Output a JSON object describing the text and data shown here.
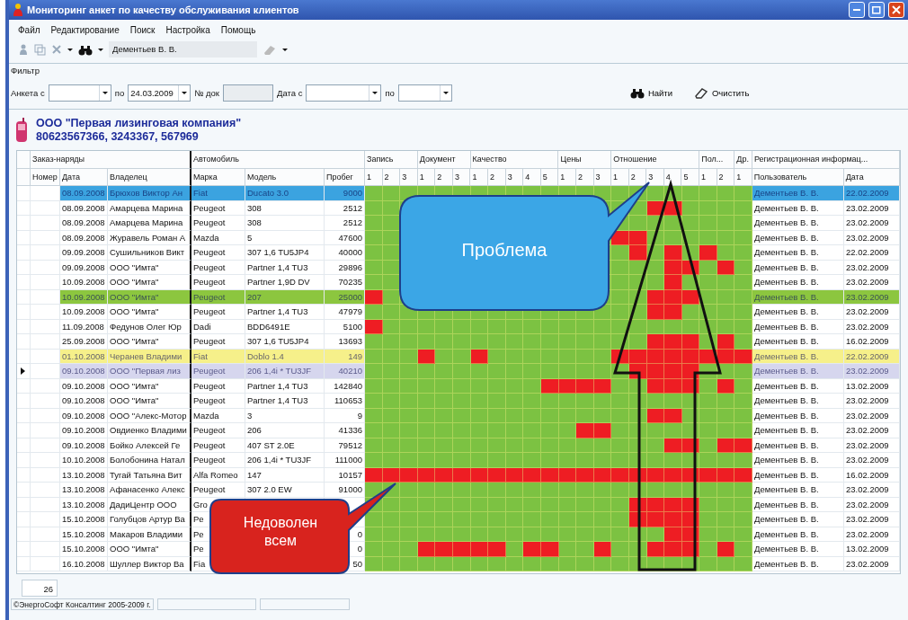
{
  "window": {
    "title": "Мониторинг анкет по качеству обслуживания клиентов"
  },
  "menu": [
    "Файл",
    "Редактирование",
    "Поиск",
    "Настройка",
    "Помощь"
  ],
  "toolbar": {
    "user_field": "Дементьев В. В."
  },
  "filter": {
    "title": "Фильтр",
    "fields": [
      {
        "label": "Анкета с",
        "kind": "combo"
      },
      {
        "label": "по",
        "kind": "combo",
        "value": "24.03.2009"
      },
      {
        "label": "№ док",
        "kind": "text"
      },
      {
        "label": "Дата с",
        "kind": "combo"
      },
      {
        "label": "по",
        "kind": "combo"
      }
    ],
    "buttons": [
      {
        "label": "Найти",
        "kind": "find"
      },
      {
        "label": "Очистить",
        "kind": "clear"
      }
    ]
  },
  "company": {
    "name": "ООО \"Первая лизинговая компания\"",
    "phones": "80623567366, 3243367, 567969"
  },
  "table": {
    "column_groups": [
      {
        "label": "Заказ-наряды",
        "kind": "order",
        "columns": [
          "Номер",
          "Дата",
          "Владелец"
        ]
      },
      {
        "label": "Автомобиль",
        "kind": "car",
        "columns": [
          "Марка",
          "Модель",
          "Пробег"
        ]
      },
      {
        "label": "Запись",
        "kind": "rating",
        "columns": [
          "1",
          "2",
          "3"
        ]
      },
      {
        "label": "Документ",
        "kind": "rating",
        "columns": [
          "1",
          "2",
          "3"
        ]
      },
      {
        "label": "Качество",
        "kind": "rating",
        "columns": [
          "1",
          "2",
          "3",
          "4",
          "5"
        ]
      },
      {
        "label": "Цены",
        "kind": "rating",
        "columns": [
          "1",
          "2",
          "3"
        ]
      },
      {
        "label": "Отношение",
        "kind": "rating",
        "columns": [
          "1",
          "2",
          "3",
          "4",
          "5"
        ]
      },
      {
        "label": "Пол...",
        "kind": "rating",
        "columns": [
          "1",
          "2"
        ]
      },
      {
        "label": "Др.",
        "kind": "rating",
        "columns": [
          "1"
        ]
      },
      {
        "label": "Регистрационная информац...",
        "kind": "registration",
        "columns": [
          "Пользователь",
          "Дата"
        ]
      }
    ],
    "rows": [
      {
        "date": "08.09.2008",
        "owner": "Брюхов Виктор Ан",
        "make": "Fiat",
        "model": "Ducato 3.0",
        "mileage": "9000",
        "complaints": [
          false,
          false,
          false,
          false,
          false,
          false,
          false,
          false,
          false,
          false,
          false,
          false,
          false,
          false,
          false,
          false,
          false,
          false,
          false,
          false,
          false,
          false
        ],
        "user": "Дементьев В. В.",
        "reg_date": "22.02.2009",
        "selected": false,
        "color": "#3ba3e0"
      },
      {
        "date": "08.09.2008",
        "owner": "Амарцева Марина",
        "make": "Peugeot",
        "model": "308",
        "mileage": "2512",
        "complaints": [
          false,
          false,
          false,
          false,
          false,
          false,
          true,
          true,
          false,
          false,
          false,
          false
        ],
        "user": "Дементьев В. В.",
        "reg_date": "23.02.2009",
        "selected": false
      },
      {
        "date": "08.09.2008",
        "owner": "Амарцева Марина",
        "make": "Peugeot",
        "model": "308",
        "mileage": "2512",
        "complaints": [
          false,
          false,
          false,
          false,
          false,
          false,
          false,
          false,
          false,
          false
        ],
        "user": "Дементьев В. В.",
        "reg_date": "23.02.2009",
        "selected": false
      },
      {
        "date": "08.09.2008",
        "owner": "Журавель Роман А",
        "make": "Mazda",
        "model": "5",
        "mileage": "47600",
        "complaints": [
          false,
          false,
          false,
          true,
          true,
          false,
          false,
          false,
          false,
          false,
          false
        ],
        "user": "Дементьев В. В.",
        "reg_date": "23.02.2009",
        "selected": false
      },
      {
        "date": "09.09.2008",
        "owner": "Сушильников Викт",
        "make": "Peugeot",
        "model": "307 1,6 TU5JP4",
        "mileage": "40000",
        "complaints": [
          false,
          false,
          false,
          false,
          true,
          false,
          true,
          false,
          true,
          false,
          false
        ],
        "user": "Дементьев В. В.",
        "reg_date": "22.02.2009",
        "selected": false
      },
      {
        "date": "09.09.2008",
        "owner": "ООО \"Имта\"",
        "make": "Peugeot",
        "model": "Partner 1,4 TU3",
        "mileage": "29896",
        "complaints": [
          false,
          false,
          false,
          false,
          false,
          false,
          true,
          true,
          false,
          true,
          false
        ],
        "user": "Дементьев В. В.",
        "reg_date": "23.02.2009",
        "selected": false
      },
      {
        "date": "10.09.2008",
        "owner": "ООО \"Имта\"",
        "make": "Peugeot",
        "model": "Partner 1,9D DV",
        "mileage": "70235",
        "complaints": [
          false,
          false,
          false,
          false,
          false,
          false,
          true,
          false,
          false,
          false,
          false
        ],
        "user": "Дементьев В. В.",
        "reg_date": "23.02.2009",
        "selected": false
      },
      {
        "date": "10.09.2008",
        "owner": "ООО \"Имта\"",
        "make": "Peugeot",
        "model": "207",
        "mileage": "25000",
        "complaints": [
          true,
          false,
          false,
          false,
          false,
          false,
          true,
          true,
          true,
          false,
          false,
          false
        ],
        "user": "Дементьев В. В.",
        "reg_date": "23.02.2009",
        "selected": false,
        "color": "#8cc63f"
      },
      {
        "date": "10.09.2008",
        "owner": "ООО \"Имта\"",
        "make": "Peugeot",
        "model": "Partner 1,4 TU3",
        "mileage": "47979",
        "complaints": [
          false,
          false,
          false,
          false,
          false,
          false,
          false,
          false,
          false,
          false,
          false,
          false,
          false,
          false,
          false,
          false,
          true,
          true,
          false,
          false,
          false,
          false
        ],
        "user": "Дементьев В. В.",
        "reg_date": "23.02.2009",
        "selected": false
      },
      {
        "date": "11.09.2008",
        "owner": "Федунов Олег Юр",
        "make": "Dadi",
        "model": "BDD6491E",
        "mileage": "5100",
        "complaints": [
          true,
          false,
          false,
          false,
          false,
          false,
          false,
          false,
          false,
          false,
          false,
          false,
          false,
          false,
          false,
          false,
          false,
          false,
          false,
          false,
          false,
          false
        ],
        "user": "Дементьев В. В.",
        "reg_date": "23.02.2009",
        "selected": false
      },
      {
        "date": "25.09.2008",
        "owner": "ООО \"Имта\"",
        "make": "Peugeot",
        "model": "307 1,6 TU5JP4",
        "mileage": "13693",
        "complaints": [
          false,
          false,
          false,
          false,
          false,
          false,
          false,
          false,
          false,
          false,
          false,
          false,
          false,
          false,
          false,
          false,
          true,
          true,
          true,
          false,
          true,
          false
        ],
        "user": "Дементьев В. В.",
        "reg_date": "16.02.2009",
        "selected": false
      },
      {
        "date": "01.10.2008",
        "owner": "Черанев Владими",
        "make": "Fiat",
        "model": "Doblo 1.4",
        "mileage": "149",
        "complaints": [
          false,
          false,
          false,
          true,
          false,
          false,
          true,
          false,
          false,
          false,
          false,
          false,
          false,
          false,
          true,
          true,
          true,
          true,
          true,
          true,
          true,
          true
        ],
        "user": "Дементьев В. В.",
        "reg_date": "22.02.2009",
        "selected": false,
        "color": "#f6f08a"
      },
      {
        "date": "09.10.2008",
        "owner": "ООО \"Первая лиз",
        "make": "Peugeot",
        "model": "206 1,4i * TU3JF",
        "mileage": "40210",
        "complaints": [
          false,
          false,
          false,
          false,
          false,
          false,
          false,
          false,
          false,
          false,
          false,
          false,
          false,
          false,
          false,
          true,
          true,
          true,
          true,
          false,
          false,
          false
        ],
        "user": "Дементьев В. В.",
        "reg_date": "23.02.2009",
        "selected": true,
        "color": "#d6d6ee"
      },
      {
        "date": "09.10.2008",
        "owner": "ООО \"Имта\"",
        "make": "Peugeot",
        "model": "Partner 1,4 TU3",
        "mileage": "142840",
        "complaints": [
          false,
          false,
          false,
          false,
          false,
          false,
          false,
          false,
          false,
          false,
          true,
          true,
          true,
          true,
          false,
          false,
          true,
          true,
          true,
          false,
          true,
          false
        ],
        "user": "Дементьев В. В.",
        "reg_date": "13.02.2009",
        "selected": false
      },
      {
        "date": "09.10.2008",
        "owner": "ООО \"Имта\"",
        "make": "Peugeot",
        "model": "Partner 1,4 TU3",
        "mileage": "110653",
        "complaints": [
          false,
          false,
          false,
          false,
          false,
          false,
          false,
          false,
          false,
          false,
          false,
          false,
          false,
          false,
          false,
          false,
          false,
          false,
          false,
          false,
          false,
          false
        ],
        "user": "Дементьев В. В.",
        "reg_date": "23.02.2009",
        "selected": false
      },
      {
        "date": "09.10.2008",
        "owner": "ООО \"Алекс-Мотор",
        "make": "Mazda",
        "model": "3",
        "mileage": "9",
        "complaints": [
          false,
          false,
          false,
          false,
          false,
          false,
          false,
          false,
          false,
          false,
          false,
          false,
          false,
          false,
          false,
          false,
          true,
          true,
          false,
          false,
          false,
          false
        ],
        "user": "Дементьев В. В.",
        "reg_date": "23.02.2009",
        "selected": false
      },
      {
        "date": "09.10.2008",
        "owner": "Овдиенко Владими",
        "make": "Peugeot",
        "model": "206",
        "mileage": "41336",
        "complaints": [
          false,
          false,
          false,
          false,
          false,
          false,
          false,
          false,
          false,
          false,
          false,
          false,
          true,
          true,
          false,
          false,
          false,
          false,
          false,
          false,
          false,
          false
        ],
        "user": "Дементьев В. В.",
        "reg_date": "23.02.2009",
        "selected": false
      },
      {
        "date": "09.10.2008",
        "owner": "Бойко Алексей Ге",
        "make": "Peugeot",
        "model": "407 ST 2.0E",
        "mileage": "79512",
        "complaints": [
          false,
          false,
          false,
          false,
          false,
          false,
          false,
          false,
          false,
          false,
          false,
          false,
          false,
          false,
          false,
          false,
          false,
          true,
          true,
          false,
          true,
          true
        ],
        "user": "Дементьев В. В.",
        "reg_date": "23.02.2009",
        "selected": false
      },
      {
        "date": "10.10.2008",
        "owner": "Болобонина Натал",
        "make": "Peugeot",
        "model": "206 1,4i * TU3JF",
        "mileage": "111000",
        "complaints": [
          false,
          false,
          false,
          false,
          false,
          false,
          false,
          false,
          false,
          false,
          false,
          false,
          false,
          false,
          false,
          false,
          false,
          false,
          false,
          false,
          false,
          false
        ],
        "user": "Дементьев В. В.",
        "reg_date": "23.02.2009",
        "selected": false
      },
      {
        "date": "13.10.2008",
        "owner": "Тугай Татьяна Вит",
        "make": "Alfa Romeo",
        "model": "147",
        "mileage": "10157",
        "complaints": [
          true,
          true,
          true,
          true,
          true,
          true,
          true,
          true,
          true,
          true,
          true,
          true,
          true,
          true,
          true,
          true,
          true,
          true,
          true,
          true,
          true,
          true
        ],
        "user": "Дементьев В. В.",
        "reg_date": "16.02.2009",
        "selected": false
      },
      {
        "date": "13.10.2008",
        "owner": "Афанасенко Алекс",
        "make": "Peugeot",
        "model": "307 2.0 EW",
        "mileage": "91000",
        "complaints": [
          false,
          false,
          false,
          false,
          false,
          false,
          false,
          false,
          false,
          false,
          false,
          false,
          false,
          false,
          false,
          false,
          false,
          false,
          false,
          false,
          false,
          false
        ],
        "user": "Дементьев В. В.",
        "reg_date": "23.02.2009",
        "selected": false
      },
      {
        "date": "13.10.2008",
        "owner": "ДадиЦентр  ООО",
        "make": "Gro",
        "complaints": [
          false,
          false,
          false,
          false,
          false,
          false,
          false,
          false,
          false,
          false,
          false,
          false,
          false,
          false,
          false,
          true,
          true,
          true,
          true,
          false,
          false,
          false
        ],
        "user": "Дементьев В. В.",
        "reg_date": "23.02.2009",
        "selected": false
      },
      {
        "date": "15.10.2008",
        "owner": "Голубцов Артур Ва",
        "make": "Pe",
        "complaints": [
          false,
          false,
          false,
          false,
          false,
          false,
          false,
          false,
          false,
          false,
          false,
          false,
          false,
          false,
          false,
          true,
          true,
          true,
          true,
          false,
          false,
          false
        ],
        "user": "Дементьев В. В.",
        "reg_date": "23.02.2009",
        "selected": false
      },
      {
        "date": "15.10.2008",
        "owner": "Макаров Владими",
        "make": "Pe",
        "mileage": "0",
        "complaints": [
          false,
          false,
          false,
          false,
          false,
          false,
          false,
          false,
          false,
          false,
          false,
          false,
          false,
          false,
          false,
          false,
          false,
          true,
          true,
          false,
          false,
          false
        ],
        "user": "Дементьев В. В.",
        "reg_date": "23.02.2009",
        "selected": false
      },
      {
        "date": "15.10.2008",
        "owner": "ООО \"Имта\"",
        "make": "Pe",
        "mileage": "0",
        "complaints": [
          false,
          false,
          false,
          true,
          true,
          true,
          true,
          true,
          false,
          true,
          true,
          false,
          false,
          true,
          false,
          false,
          true,
          true,
          true,
          false,
          true,
          false
        ],
        "user": "Дементьев В. В.",
        "reg_date": "13.02.2009",
        "selected": false
      },
      {
        "date": "16.10.2008",
        "owner": "Шуллер Виктор Ва",
        "make": "Fia",
        "mileage": "50",
        "complaints": [
          false,
          false,
          false,
          false,
          false,
          false,
          false,
          false,
          false,
          false,
          false,
          false,
          false,
          false,
          false,
          false,
          false,
          false,
          false,
          false,
          false,
          false
        ],
        "user": "Дементьев В. В.",
        "reg_date": "23.02.2009",
        "selected": false
      }
    ]
  },
  "callouts": [
    {
      "text": "Проблема",
      "color": "#3ba6e6"
    },
    {
      "text": "Недоволен всем",
      "color": "#d8231e"
    }
  ],
  "record_count": "26",
  "status_bar": "©ЭнергоСофт Консалтинг 2005-2009 г."
}
